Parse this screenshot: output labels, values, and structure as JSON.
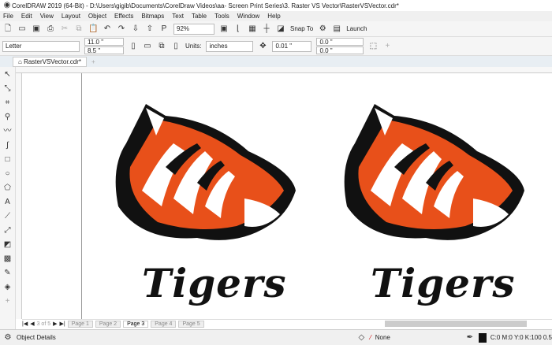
{
  "title": "CorelDRAW 2019 (64-Bit) - D:\\Users\\gigib\\Documents\\CorelDraw Videos\\aa- Screen Print Series\\3. Raster VS Vector\\RasterVSVector.cdr*",
  "menu": [
    "File",
    "Edit",
    "View",
    "Layout",
    "Object",
    "Effects",
    "Bitmaps",
    "Text",
    "Table",
    "Tools",
    "Window",
    "Help"
  ],
  "toolbar": {
    "zoom": "92%",
    "snap_to": "Snap To",
    "launch": "Launch"
  },
  "props": {
    "page_size": "Letter",
    "width": "11.0 \"",
    "height": "8.5 \"",
    "units_label": "Units:",
    "units": "inches",
    "nudge": "0.01 \"",
    "dup_x": "0.0 \"",
    "dup_y": "0.0 \""
  },
  "doc_tab": "RasterVSVector.cdr*",
  "pages": {
    "counter": "3 of 5",
    "tabs": [
      "Page 1",
      "Page 2",
      "Page 3",
      "Page 4",
      "Page 5"
    ],
    "active": 2
  },
  "logo_text": "Tigers",
  "status": {
    "object_details": "Object Details",
    "fill": "None",
    "outline": "C:0 M:0 Y:0 K:100 0.5"
  },
  "colors": {
    "orange": "#e8501a",
    "black": "#111111"
  }
}
